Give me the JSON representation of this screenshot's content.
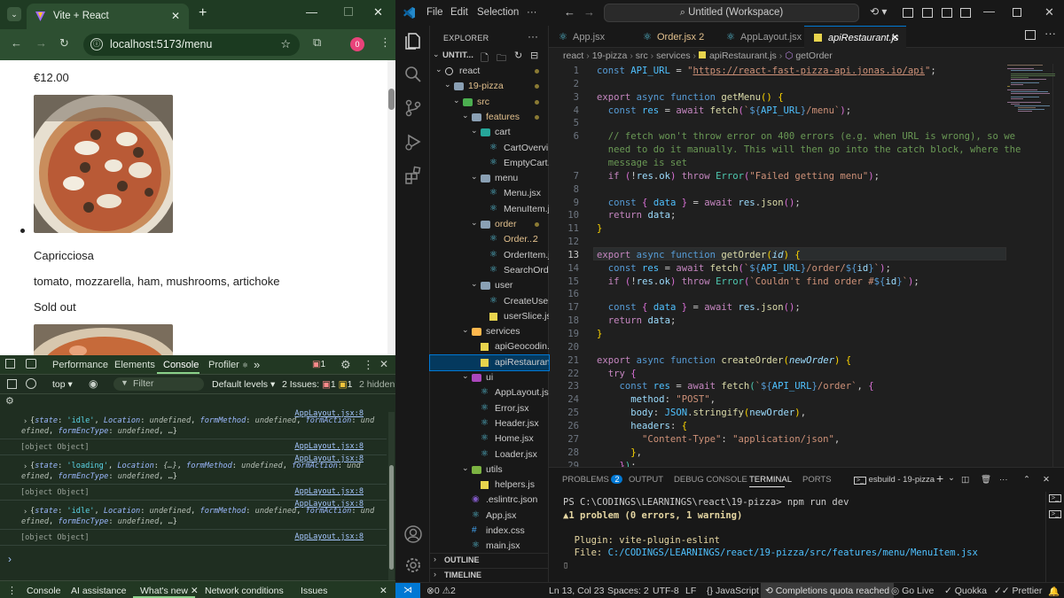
{
  "browser": {
    "tab_title": "Vite + React",
    "url": "localhost:5173/menu",
    "profile_initial": "0",
    "page": {
      "price": "€12.00",
      "item_name": "Capricciosa",
      "ingredients": "tomato, mozzarella, ham, mushrooms, artichoke",
      "status": "Sold out"
    },
    "devtools": {
      "tabs": [
        "Performance",
        "Elements",
        "Console",
        "Profiler"
      ],
      "active_tab": "Console",
      "profiler_mark": "⚛",
      "more": "»",
      "error_count": "1",
      "context": "top",
      "filter_placeholder": "Filter",
      "levels": "Default levels",
      "issues_label": "2 Issues:",
      "issues_err": "1",
      "issues_warn": "1",
      "hidden": "2 hidden",
      "logs": [
        {
          "src": "AppLayout.jsx:8",
          "state": "'idle'",
          "location": "undefined",
          "formMethod": "undefined",
          "formAction": "undefined",
          "formEncType": "undefined",
          "tail": ", …}"
        },
        {
          "obj": "[object Object]",
          "src": "AppLayout.jsx:8"
        },
        {
          "src": "AppLayout.jsx:8",
          "state": "'loading'",
          "location": "{…}",
          "formMethod": "undefined",
          "formAction": "undefined",
          "formEncType": "undefined",
          "tail": ", …}"
        },
        {
          "obj": "[object Object]",
          "src": "AppLayout.jsx:8"
        },
        {
          "src": "AppLayout.jsx:8",
          "state": "'idle'",
          "location": "undefined",
          "formMethod": "undefined",
          "formAction": "undefined",
          "formEncType": "undefined",
          "tail": ", …}"
        },
        {
          "obj": "[object Object]",
          "src": "AppLayout.jsx:8"
        }
      ],
      "prompt": "›",
      "drawer": [
        "Console",
        "AI assistance",
        "What's new",
        "Network conditions",
        "Issues"
      ]
    }
  },
  "vscode": {
    "menu": [
      "File",
      "Edit",
      "Selection",
      "···"
    ],
    "command_center": "Untitled (Workspace)",
    "explorer_title": "EXPLORER",
    "workspace": "UNTIT...",
    "tree": [
      {
        "label": "react",
        "depth": 0,
        "type": "root",
        "open": true,
        "dot": true
      },
      {
        "label": "19-pizza",
        "depth": 1,
        "type": "folder",
        "open": true,
        "dot": true,
        "orange": true
      },
      {
        "label": "src",
        "depth": 2,
        "type": "folder-src",
        "open": true,
        "dot": true,
        "orange": true
      },
      {
        "label": "features",
        "depth": 3,
        "type": "folder",
        "open": true,
        "dot": true,
        "orange": true
      },
      {
        "label": "cart",
        "depth": 4,
        "type": "folder-cart",
        "open": true
      },
      {
        "label": "CartOvervi...",
        "depth": 5,
        "type": "react"
      },
      {
        "label": "EmptyCart.j...",
        "depth": 5,
        "type": "react"
      },
      {
        "label": "menu",
        "depth": 4,
        "type": "folder",
        "open": true
      },
      {
        "label": "Menu.jsx",
        "depth": 5,
        "type": "react"
      },
      {
        "label": "MenuItem.j...",
        "depth": 5,
        "type": "react"
      },
      {
        "label": "order",
        "depth": 4,
        "type": "folder",
        "open": true,
        "dot": true,
        "orange": true
      },
      {
        "label": "Order....",
        "depth": 5,
        "type": "react",
        "badge": "2",
        "orange": true
      },
      {
        "label": "OrderItem.j...",
        "depth": 5,
        "type": "react"
      },
      {
        "label": "SearchOrd...",
        "depth": 5,
        "type": "react"
      },
      {
        "label": "user",
        "depth": 4,
        "type": "folder",
        "open": true
      },
      {
        "label": "CreateUser....",
        "depth": 5,
        "type": "react"
      },
      {
        "label": "userSlice.js",
        "depth": 5,
        "type": "js"
      },
      {
        "label": "services",
        "depth": 3,
        "type": "folder-services",
        "open": true
      },
      {
        "label": "apiGeocodin...",
        "depth": 4,
        "type": "js"
      },
      {
        "label": "apiRestauran...",
        "depth": 4,
        "type": "js",
        "selected": true
      },
      {
        "label": "ui",
        "depth": 3,
        "type": "folder-ui",
        "open": true
      },
      {
        "label": "AppLayout.jsx",
        "depth": 4,
        "type": "react"
      },
      {
        "label": "Error.jsx",
        "depth": 4,
        "type": "react"
      },
      {
        "label": "Header.jsx",
        "depth": 4,
        "type": "react"
      },
      {
        "label": "Home.jsx",
        "depth": 4,
        "type": "react"
      },
      {
        "label": "Loader.jsx",
        "depth": 4,
        "type": "react"
      },
      {
        "label": "utils",
        "depth": 3,
        "type": "folder-utils",
        "open": true
      },
      {
        "label": "helpers.js",
        "depth": 4,
        "type": "js"
      },
      {
        "label": ".eslintrc.json",
        "depth": 3,
        "type": "eslint"
      },
      {
        "label": "App.jsx",
        "depth": 3,
        "type": "react"
      },
      {
        "label": "index.css",
        "depth": 3,
        "type": "css"
      },
      {
        "label": "main.jsx",
        "depth": 3,
        "type": "react"
      }
    ],
    "outline": "OUTLINE",
    "timeline": "TIMELINE",
    "tabs": [
      {
        "label": "App.jsx"
      },
      {
        "label": "Order.jsx",
        "badge": "2"
      },
      {
        "label": "AppLayout.jsx"
      },
      {
        "label": "apiRestaurant.js",
        "active": true
      }
    ],
    "breadcrumbs": [
      "react",
      "19-pizza",
      "src",
      "services",
      "apiRestaurant.js",
      "getOrder"
    ],
    "code": [
      {
        "n": "1",
        "html": "<span class='kb'>const</span> <span class='cn'>API_URL</span> = <span class='s'>\"</span><span class='s' style='text-decoration:underline'>https://react-fast-pizza-api.jonas.io/api</span><span class='s'>\"</span>;"
      },
      {
        "n": "2",
        "html": ""
      },
      {
        "n": "3",
        "html": "<span class='k'>export</span> <span class='kb'>async</span> <span class='kb'>function</span> <span class='f'>getMenu</span><span class='p'>()</span> <span class='p'>{</span>"
      },
      {
        "n": "4",
        "html": "  <span class='kb'>const</span> <span class='cn'>res</span> = <span class='k'>await</span> <span class='f'>fetch</span><span class='pp'>(</span><span class='s'>`</span><span class='kb'>${</span><span class='cn'>API_URL</span><span class='kb'>}</span><span class='s'>/menu`</span><span class='pp'>)</span>;"
      },
      {
        "n": "5",
        "html": ""
      },
      {
        "n": "6",
        "html": "  <span class='c'>// fetch won't throw error on 400 errors (e.g. when URL is wrong), so we</span>"
      },
      {
        "n": "",
        "html": "  <span class='c'>need to do it manually. This will then go into the catch block, where the</span>"
      },
      {
        "n": "",
        "html": "  <span class='c'>message is set</span>"
      },
      {
        "n": "7",
        "html": "  <span class='k'>if</span> <span class='pp'>(</span>!<span class='v'>res</span>.<span class='v'>ok</span><span class='pp'>)</span> <span class='k'>throw</span> <span class='t'>Error</span><span class='pp'>(</span><span class='s'>\"Failed getting menu\"</span><span class='pp'>)</span>;"
      },
      {
        "n": "8",
        "html": ""
      },
      {
        "n": "9",
        "html": "  <span class='kb'>const</span> <span class='pp'>{</span> <span class='cn'>data</span> <span class='pp'>}</span> = <span class='k'>await</span> <span class='v'>res</span>.<span class='f'>json</span><span class='pp'>()</span>;"
      },
      {
        "n": "10",
        "html": "  <span class='k'>return</span> <span class='v'>data</span>;"
      },
      {
        "n": "11",
        "html": "<span class='p'>}</span>"
      },
      {
        "n": "12",
        "html": ""
      },
      {
        "n": "13",
        "html": "<span class='k'>export</span> <span class='kb'>async</span> <span class='kb'>function</span> <span class='f'>getOrder</span><span class='p'>(</span><span class='pa'>id</span><span class='p'>)</span> <span class='p'>{</span>"
      },
      {
        "n": "14",
        "html": "  <span class='kb'>const</span> <span class='cn'>res</span> = <span class='k'>await</span> <span class='f'>fetch</span><span class='pp'>(</span><span class='s'>`</span><span class='kb'>${</span><span class='cn'>API_URL</span><span class='kb'>}</span><span class='s'>/order/</span><span class='kb'>${</span><span class='v'>id</span><span class='kb'>}</span><span class='s'>`</span><span class='pp'>)</span>;"
      },
      {
        "n": "15",
        "html": "  <span class='k'>if</span> <span class='pp'>(</span>!<span class='v'>res</span>.<span class='v'>ok</span><span class='pp'>)</span> <span class='k'>throw</span> <span class='t'>Error</span><span class='pp'>(</span><span class='s'>`Couldn't find order #</span><span class='kb'>${</span><span class='v'>id</span><span class='kb'>}</span><span class='s'>`</span><span class='pp'>)</span>;"
      },
      {
        "n": "16",
        "html": ""
      },
      {
        "n": "17",
        "html": "  <span class='kb'>const</span> <span class='pp'>{</span> <span class='cn'>data</span> <span class='pp'>}</span> = <span class='k'>await</span> <span class='v'>res</span>.<span class='f'>json</span><span class='pp'>()</span>;"
      },
      {
        "n": "18",
        "html": "  <span class='k'>return</span> <span class='v'>data</span>;"
      },
      {
        "n": "19",
        "html": "<span class='p'>}</span>"
      },
      {
        "n": "20",
        "html": ""
      },
      {
        "n": "21",
        "html": "<span class='k'>export</span> <span class='kb'>async</span> <span class='kb'>function</span> <span class='f'>createOrder</span><span class='p'>(</span><span class='pa'>newOrder</span><span class='p'>)</span> <span class='p'>{</span>"
      },
      {
        "n": "22",
        "html": "  <span class='k'>try</span> <span class='pp'>{</span>"
      },
      {
        "n": "23",
        "html": "    <span class='kb'>const</span> <span class='cn'>res</span> = <span class='k'>await</span> <span class='f'>fetch</span><span class='t'>(</span><span class='s'>`</span><span class='kb'>${</span><span class='cn'>API_URL</span><span class='kb'>}</span><span class='s'>/order`</span>, <span class='pp'>{</span>"
      },
      {
        "n": "24",
        "html": "      <span class='v'>method</span>: <span class='s'>\"POST\"</span>,"
      },
      {
        "n": "25",
        "html": "      <span class='v'>body</span>: <span class='cn'>JSON</span>.<span class='f'>stringify</span><span class='p'>(</span><span class='v'>newOrder</span><span class='p'>)</span>,"
      },
      {
        "n": "26",
        "html": "      <span class='v'>headers</span>: <span class='p'>{</span>"
      },
      {
        "n": "27",
        "html": "        <span class='s'>\"Content-Type\"</span>: <span class='s'>\"application/json\"</span>,"
      },
      {
        "n": "28",
        "html": "      <span class='p'>}</span>,"
      },
      {
        "n": "29",
        "html": "    <span class='pp'>}</span><span class='t'>)</span>;"
      }
    ],
    "current_line": "13",
    "panel": {
      "tabs": [
        "PROBLEMS",
        "OUTPUT",
        "DEBUG CONSOLE",
        "TERMINAL",
        "PORTS"
      ],
      "problems_count": "2",
      "active": "TERMINAL",
      "terminal_name": "esbuild - 19-pizza",
      "lines": [
        "PS C:\\CODINGS\\LEARNINGS\\react\\19-pizza> npm run dev",
        "1 problem (0 errors, 1 warning)",
        "",
        "  Plugin: vite-plugin-eslint",
        "  File: C:/CODINGS/LEARNINGS/react/19-pizza/src/features/menu/MenuItem.jsx",
        "▯"
      ]
    },
    "status": {
      "errors": "0",
      "warnings": "2",
      "position": "Ln 13, Col 23",
      "spaces": "Spaces: 2",
      "encoding": "UTF-8",
      "eol": "LF",
      "language": "JavaScript",
      "copilot": "Completions quota reached",
      "golive": "Go Live",
      "quokka": "Quokka",
      "prettier": "Prettier"
    }
  }
}
